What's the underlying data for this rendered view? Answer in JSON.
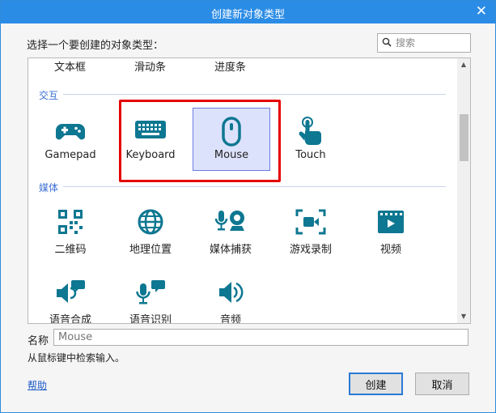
{
  "window": {
    "title": "创建新对象类型",
    "close_glyph": "✕"
  },
  "prompt": "选择一个要创建的对象类型：",
  "search": {
    "placeholder": "搜索"
  },
  "top_row_items": [
    "文本框",
    "滑动条",
    "进度条"
  ],
  "categories": {
    "interaction": {
      "label": "交互",
      "items": [
        {
          "label": "Gamepad",
          "icon": "gamepad-icon"
        },
        {
          "label": "Keyboard",
          "icon": "keyboard-icon"
        },
        {
          "label": "Mouse",
          "icon": "mouse-icon",
          "selected": true
        },
        {
          "label": "Touch",
          "icon": "touch-icon"
        }
      ]
    },
    "media": {
      "label": "媒体",
      "items": [
        {
          "label": "二维码",
          "icon": "qr-code-icon"
        },
        {
          "label": "地理位置",
          "icon": "globe-icon"
        },
        {
          "label": "媒体捕获",
          "icon": "mic-camera-icon"
        },
        {
          "label": "游戏录制",
          "icon": "record-icon"
        },
        {
          "label": "视频",
          "icon": "video-icon"
        },
        {
          "label": "语音合成",
          "icon": "speech-synthesis-icon"
        },
        {
          "label": "语音识别",
          "icon": "speech-recognition-icon"
        },
        {
          "label": "音频",
          "icon": "audio-icon"
        }
      ]
    }
  },
  "name_field": {
    "label": "名称",
    "value": "Mouse"
  },
  "description": "从鼠标键中检索输入。",
  "help_link": "帮助",
  "buttons": {
    "create": "创建",
    "cancel": "取消"
  },
  "colors": {
    "accent": "#2b8ce6",
    "icon": "#0e7791",
    "selection": "#dde2fc",
    "highlight_box": "#e60000",
    "category": "#3b6fd4"
  }
}
